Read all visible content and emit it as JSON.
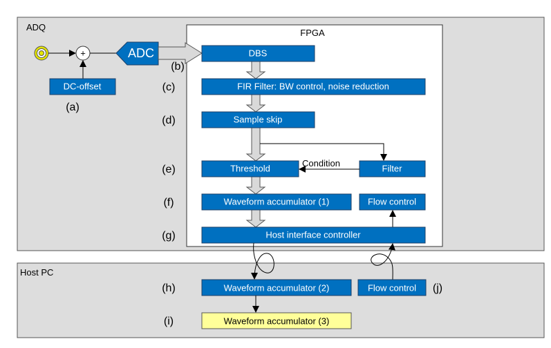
{
  "adq": {
    "title": "ADQ"
  },
  "fpga": {
    "title": "FPGA"
  },
  "host": {
    "title": "Host PC"
  },
  "inputs": {
    "adder_symbol": "+",
    "dc_offset": "DC-offset",
    "adc": "ADC"
  },
  "blocks": {
    "dbs": "DBS",
    "fir": "FIR Filter: BW control, noise reduction",
    "sample_skip": "Sample skip",
    "threshold": "Threshold",
    "filter": "Filter",
    "condition": "Condition",
    "wa1": "Waveform accumulator (1)",
    "flow_fpga": "Flow control",
    "host_if": "Host interface controller",
    "wa2": "Waveform accumulator (2)",
    "flow_host": "Flow control",
    "wa3": "Waveform accumulator (3)"
  },
  "labels": {
    "a": "(a)",
    "b": "(b)",
    "c": "(c)",
    "d": "(d)",
    "e": "(e)",
    "f": "(f)",
    "g": "(g)",
    "h": "(h)",
    "i": "(i)",
    "j": "(j)"
  },
  "colors": {
    "block": "#0070c0",
    "highlight": "#ffff99",
    "panel": "#dddddd",
    "connector": "#e6e600"
  }
}
